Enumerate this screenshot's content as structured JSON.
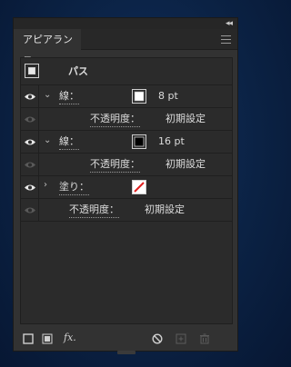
{
  "panel": {
    "collapse_label": "◂◂",
    "tab_label": "アピアランス"
  },
  "header_row": {
    "label": "パス"
  },
  "rows": [
    {
      "type": "stroke",
      "label": "線：",
      "value": "8 pt",
      "swatch": "white"
    },
    {
      "type": "opacity",
      "label": "不透明度：",
      "value": "初期設定"
    },
    {
      "type": "stroke",
      "label": "線：",
      "value": "16 pt",
      "swatch": "black"
    },
    {
      "type": "opacity",
      "label": "不透明度：",
      "value": "初期設定"
    },
    {
      "type": "fill",
      "label": "塗り：",
      "swatch": "none"
    },
    {
      "type": "opacity",
      "label": "不透明度：",
      "value": "初期設定"
    }
  ],
  "bottom": {
    "fx_label": "fx."
  },
  "colors": {
    "panel_bg": "#323232",
    "list_bg": "#2b2b2b",
    "none_swatch_slash": "#e02020"
  }
}
